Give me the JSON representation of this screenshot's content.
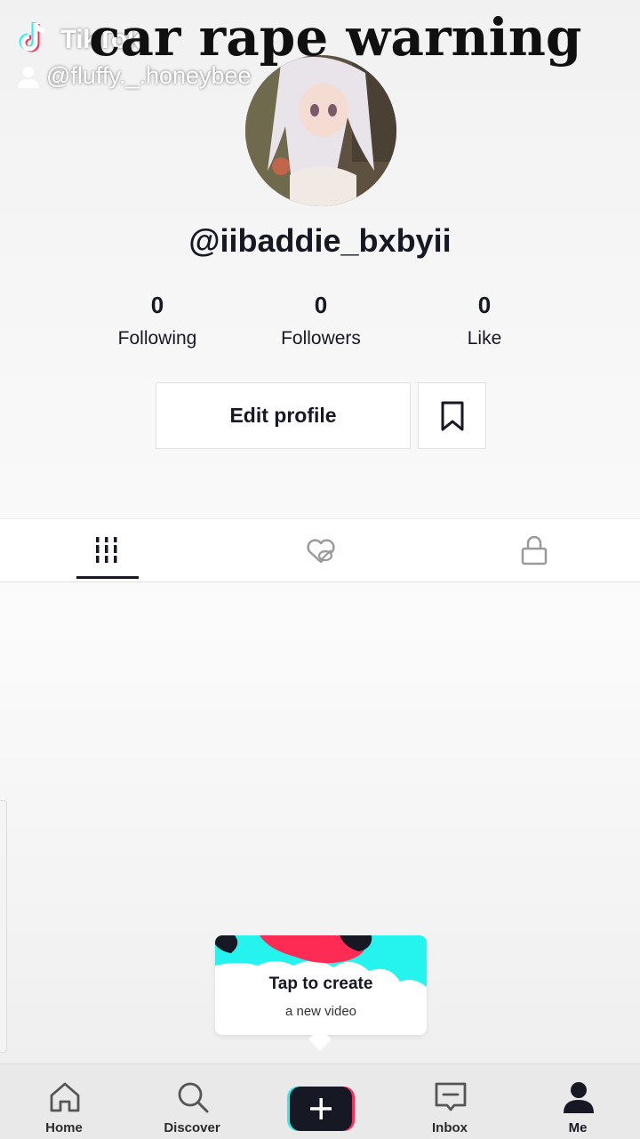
{
  "watermark": {
    "brand": "TikTok",
    "username": "@fluffy._.honeybee"
  },
  "overlay_caption": "car rape warning",
  "profile": {
    "username": "@iibaddie_bxbyii",
    "stats": [
      {
        "value": "0",
        "label": "Following"
      },
      {
        "value": "0",
        "label": "Followers"
      },
      {
        "value": "0",
        "label": "Like"
      }
    ],
    "edit_button": "Edit profile"
  },
  "tabs": [
    {
      "icon": "grid-icon",
      "active": true
    },
    {
      "icon": "liked-hidden-icon",
      "active": false
    },
    {
      "icon": "lock-icon",
      "active": false
    }
  ],
  "create_prompt": {
    "title": "Tap to create",
    "subtitle": "a new video"
  },
  "bottom_nav": [
    {
      "label": "Home",
      "icon": "home-icon"
    },
    {
      "label": "Discover",
      "icon": "search-icon"
    },
    {
      "label": "",
      "icon": "plus-icon"
    },
    {
      "label": "Inbox",
      "icon": "inbox-icon"
    },
    {
      "label": "Me",
      "icon": "person-icon"
    }
  ],
  "colors": {
    "accent_cyan": "#25F4EE",
    "accent_red": "#FE2C55",
    "text": "#161823"
  }
}
